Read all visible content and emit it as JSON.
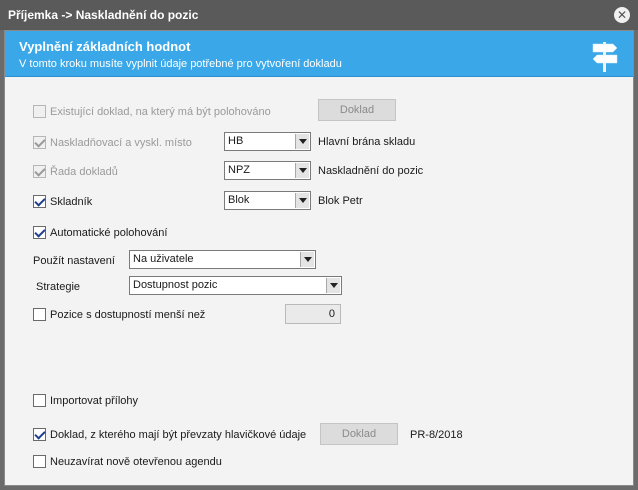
{
  "window": {
    "title": "Příjemka -> Naskladnění do pozic",
    "close_icon": "close-icon"
  },
  "header": {
    "title": "Vyplnění základních hodnot",
    "subtitle": "V tomto kroku musíte vyplnit údaje potřebné pro vytvoření dokladu",
    "icon": "signpost-icon"
  },
  "form": {
    "existing_doc": {
      "label": "Existující doklad, na který má být polohováno",
      "checked": false,
      "enabled": false,
      "button": "Doklad"
    },
    "place": {
      "label": "Naskladňovací a vyskl. místo",
      "checked": true,
      "enabled": false,
      "value": "HB",
      "description": "Hlavní brána skladu"
    },
    "series": {
      "label": "Řada dokladů",
      "checked": true,
      "enabled": false,
      "value": "NPZ",
      "description": "Naskladnění do pozic"
    },
    "storekeeper": {
      "label": "Skladník",
      "checked": true,
      "enabled": true,
      "value": "Blok",
      "description": "Blok Petr"
    },
    "auto_positioning": {
      "label": "Automatické polohování",
      "checked": true
    },
    "use_settings": {
      "label": "Použít nastavení",
      "value": "Na uživatele"
    },
    "strategy": {
      "label": "Strategie",
      "value": "Dostupnost pozic"
    },
    "low_availability": {
      "label": "Pozice s dostupností menší než",
      "checked": false,
      "value": "0"
    },
    "import_attachments": {
      "label": "Importovat přílohy",
      "checked": false
    },
    "header_source": {
      "label": "Doklad, z kterého mají být převzaty hlavičkové údaje",
      "checked": true,
      "button": "Doklad",
      "value": "PR-8/2018"
    },
    "keep_open": {
      "label": "Neuzavírat nově otevřenou agendu",
      "checked": false
    }
  }
}
